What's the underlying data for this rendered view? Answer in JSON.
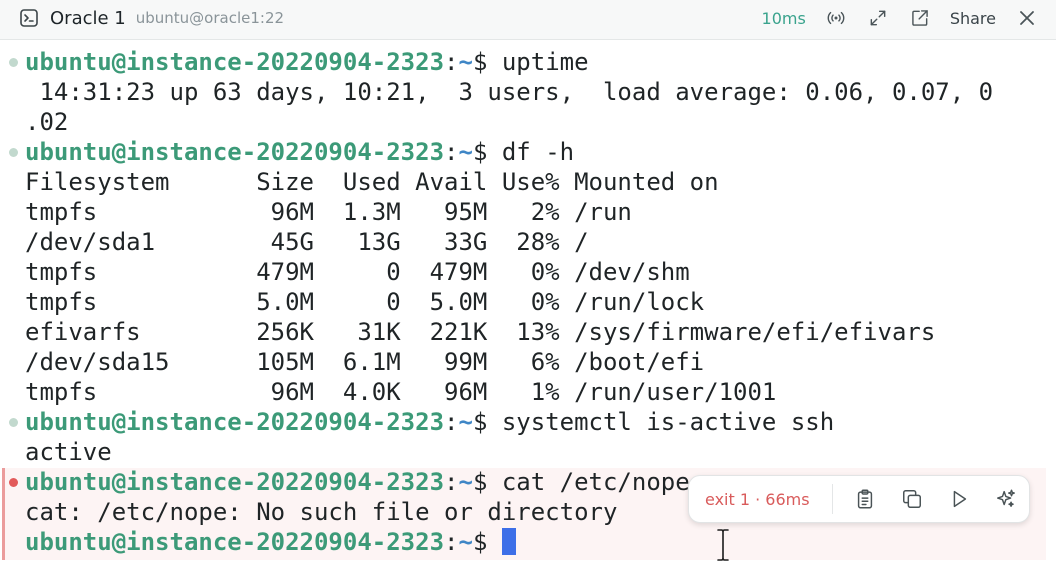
{
  "window": {
    "title": "Oracle 1",
    "subtitle": "ubuntu@oracle1:22",
    "latency": "10ms",
    "share_label": "Share"
  },
  "prompt": {
    "user_host": "ubuntu@instance-20220904-2323",
    "colon": ":",
    "path": "~",
    "symbol": "$"
  },
  "lines": {
    "cmd_uptime": " uptime",
    "uptime_out_1": " 14:31:23 up 63 days, 10:21,  3 users,  load average: 0.06, 0.07, 0",
    "uptime_out_2": ".02",
    "cmd_df": " df -h",
    "df_rows": [
      "Filesystem      Size  Used Avail Use% Mounted on",
      "tmpfs            96M  1.3M   95M   2% /run",
      "/dev/sda1        45G   13G   33G  28% /",
      "tmpfs           479M     0  479M   0% /dev/shm",
      "tmpfs           5.0M     0  5.0M   0% /run/lock",
      "efivarfs        256K   31K  221K  13% /sys/firmware/efi/efivars",
      "/dev/sda15      105M  6.1M   99M   6% /boot/efi",
      "tmpfs            96M  4.0K   96M   1% /run/user/1001"
    ],
    "cmd_systemctl": " systemctl is-active ssh",
    "systemctl_out": "active",
    "cmd_cat": " cat /etc/nope",
    "cat_out": "cat: /etc/nope: No such file or directory",
    "cmd_current": " "
  },
  "action_bar": {
    "status": "exit 1 · 66ms"
  },
  "colors": {
    "prompt_user": "#3c9a78",
    "prompt_path": "#3f86c6",
    "error": "#e25a5a",
    "cursor": "#3d6fe8",
    "latency": "#3aa38d"
  },
  "icons": {
    "terminal": "terminal-icon",
    "broadcast": "broadcast-icon",
    "expand": "expand-icon",
    "open_external": "open-external-icon",
    "close": "close-icon",
    "clipboard": "clipboard-icon",
    "copy": "copy-icon",
    "run": "play-icon",
    "ai": "sparkle-icon"
  }
}
